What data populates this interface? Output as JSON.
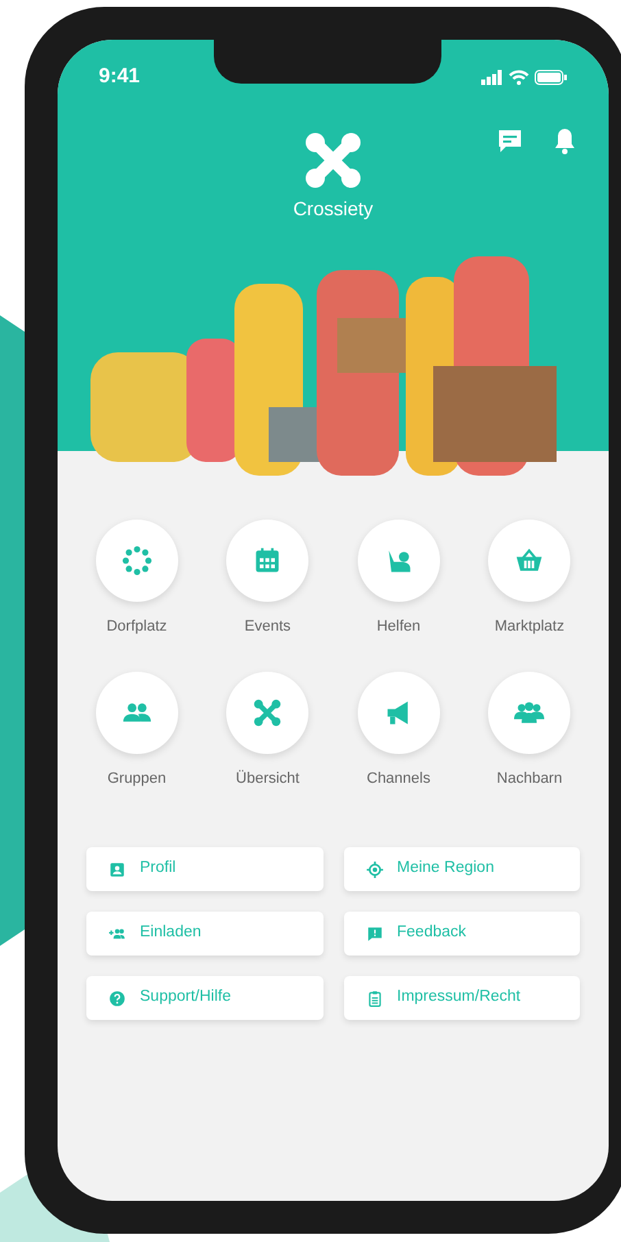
{
  "status_bar": {
    "time": "9:41"
  },
  "header": {
    "app_name": "Crossiety"
  },
  "tiles": [
    {
      "label": "Dorfplatz"
    },
    {
      "label": "Events"
    },
    {
      "label": "Helfen"
    },
    {
      "label": "Marktplatz"
    },
    {
      "label": "Gruppen"
    },
    {
      "label": "Übersicht"
    },
    {
      "label": "Channels"
    },
    {
      "label": "Nachbarn"
    }
  ],
  "links": [
    {
      "label": "Profil"
    },
    {
      "label": "Meine Region"
    },
    {
      "label": "Einladen"
    },
    {
      "label": "Feedback"
    },
    {
      "label": "Support/Hilfe"
    },
    {
      "label": "Impressum/Recht"
    }
  ]
}
